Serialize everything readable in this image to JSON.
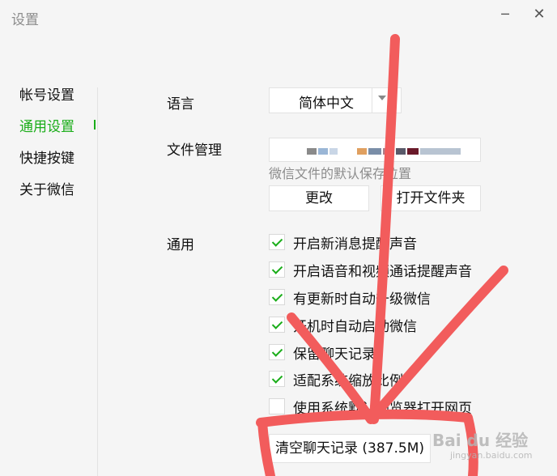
{
  "window": {
    "title": "设置",
    "minimize_glyph": "─",
    "close_glyph": "✕"
  },
  "sidebar": {
    "items": [
      {
        "label": "帐号设置"
      },
      {
        "label": "通用设置"
      },
      {
        "label": "快捷按键"
      },
      {
        "label": "关于微信"
      }
    ],
    "active_index": 1
  },
  "settings": {
    "language": {
      "label": "语言",
      "value": "简体中文"
    },
    "file_management": {
      "label": "文件管理",
      "hint": "微信文件的默认保存位置",
      "change_button": "更改",
      "open_folder_button": "打开文件夹"
    },
    "general": {
      "label": "通用",
      "options": [
        {
          "label": "开启新消息提醒声音",
          "checked": true
        },
        {
          "label": "开启语音和视频通话提醒声音",
          "checked": true
        },
        {
          "label": "有更新时自动升级微信",
          "checked": true
        },
        {
          "label": "开机时自动启动微信",
          "checked": true
        },
        {
          "label": "保留聊天记录",
          "checked": true
        },
        {
          "label": "适配系统缩放比例",
          "checked": true
        },
        {
          "label": "使用系统默认浏览器打开网页",
          "checked": false
        }
      ]
    },
    "clear_history_button": "清空聊天记录 (387.5M)"
  },
  "watermark": {
    "text": "Bai du 经验",
    "sub": "jingyan.baidu.com"
  },
  "colors": {
    "accent": "#1aad19",
    "annotation": "#f25c5c"
  },
  "icons": {
    "window_minimize": "minimize-icon",
    "window_close": "close-icon",
    "checkbox_check": "check-icon",
    "dropdown": "chevron-down-icon"
  }
}
